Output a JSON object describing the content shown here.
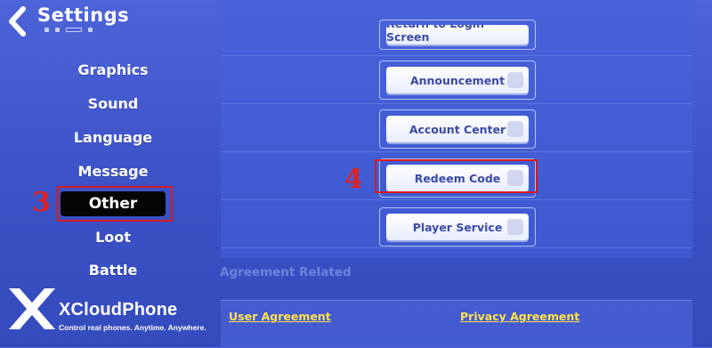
{
  "header": {
    "title": "Settings"
  },
  "sidebar": {
    "items": [
      {
        "label": "Graphics"
      },
      {
        "label": "Sound"
      },
      {
        "label": "Language"
      },
      {
        "label": "Message"
      },
      {
        "label": "Other"
      },
      {
        "label": "Loot"
      },
      {
        "label": "Battle"
      }
    ],
    "active": "Other"
  },
  "main": {
    "buttons": {
      "partial": "Return to Login Screen",
      "announcement": "Announcement",
      "account_center": "Account Center",
      "redeem_code": "Redeem Code",
      "player_service": "Player Service"
    }
  },
  "annotations": {
    "step3": "3",
    "step4": "4"
  },
  "agreement": {
    "title": "Agreement Related",
    "user_agreement": "User Agreement",
    "privacy_agreement": "Privacy Agreement"
  },
  "watermark": {
    "brand": "XCloudPhone",
    "tagline": "Control real phones. Anytime. Anywhere."
  }
}
